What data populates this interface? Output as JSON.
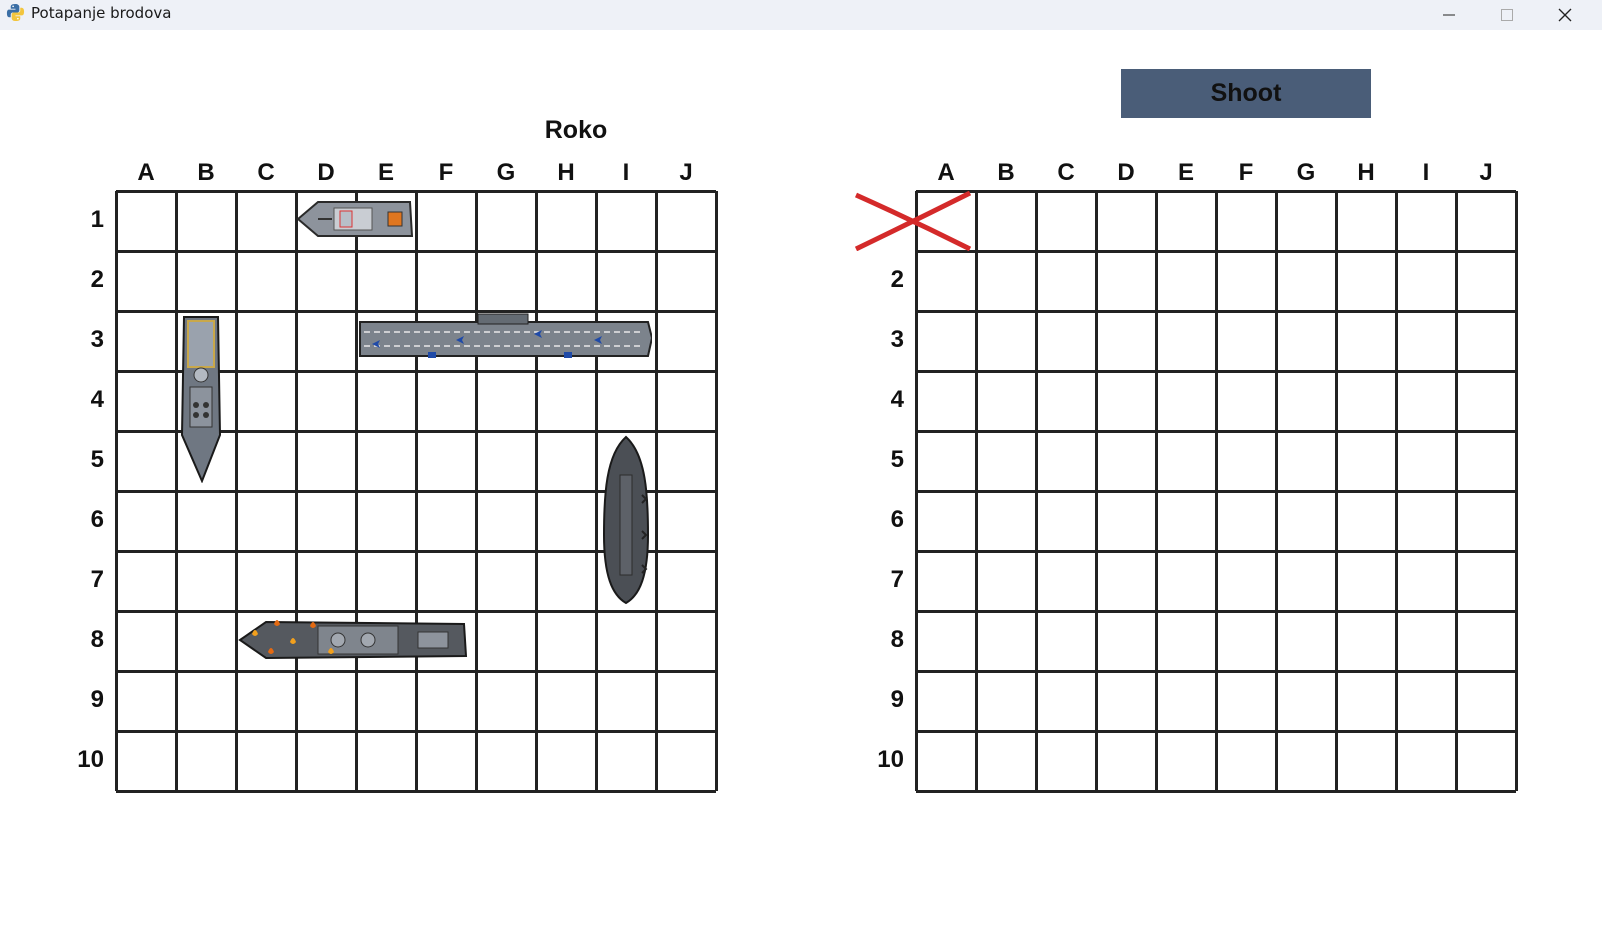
{
  "window": {
    "title": "Potapanje brodova"
  },
  "controls": {
    "shoot_label": "Shoot"
  },
  "player": {
    "name": "Roko"
  },
  "columns": [
    "A",
    "B",
    "C",
    "D",
    "E",
    "F",
    "G",
    "H",
    "I",
    "J"
  ],
  "rows": [
    "1",
    "2",
    "3",
    "4",
    "5",
    "6",
    "7",
    "8",
    "9",
    "10"
  ],
  "own_board": {
    "ships": [
      {
        "name": "patrol-boat",
        "start": "D1",
        "end": "E1",
        "orientation": "horizontal"
      },
      {
        "name": "destroyer",
        "start": "B3",
        "end": "B5",
        "orientation": "vertical"
      },
      {
        "name": "aircraft-carrier",
        "start": "E3",
        "end": "I3",
        "orientation": "horizontal"
      },
      {
        "name": "submarine",
        "start": "I5",
        "end": "I7",
        "orientation": "vertical"
      },
      {
        "name": "battleship",
        "start": "C8",
        "end": "F8",
        "orientation": "horizontal",
        "status": "on-fire"
      }
    ]
  },
  "target_board": {
    "shots": [
      {
        "cell": "A1",
        "result": "miss",
        "marker": "red-x"
      }
    ]
  },
  "colors": {
    "shoot_button": "#4a5d78",
    "grid": "#222222",
    "miss_marker": "#d42a2a",
    "titlebar": "#eef1f7"
  }
}
